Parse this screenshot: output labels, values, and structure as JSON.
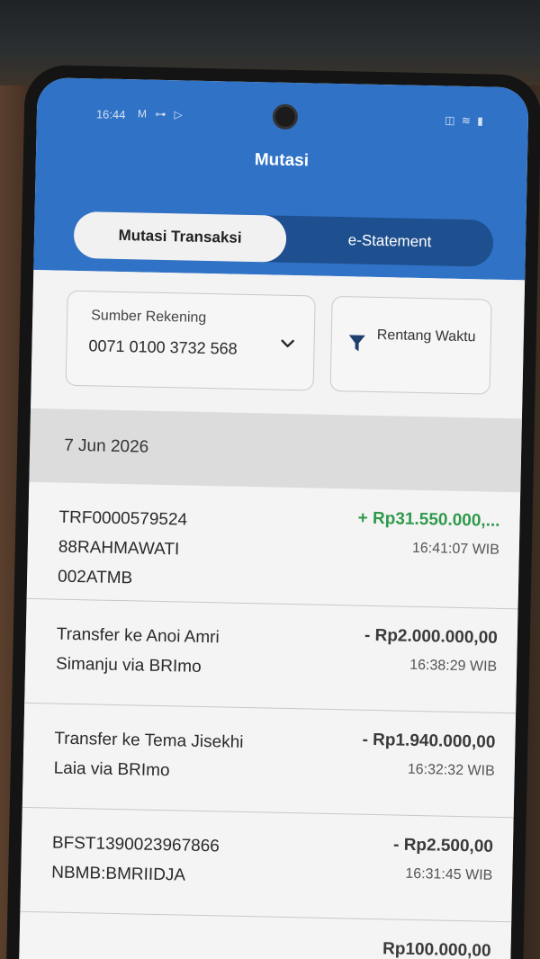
{
  "status_bar": {
    "time": "16:44",
    "left_icons": "M ⊶ ▷",
    "right_icons": "◫ ≋ ▮"
  },
  "header": {
    "title": "Mutasi",
    "tabs": [
      {
        "label": "Mutasi Transaksi",
        "active": true
      },
      {
        "label": "e-Statement",
        "active": false
      }
    ]
  },
  "filters": {
    "account": {
      "label": "Sumber Rekening",
      "value": "0071 0100 3732 568",
      "icon": "chevron-down-icon"
    },
    "range": {
      "label": "Rentang Waktu",
      "icon": "filter-icon"
    }
  },
  "date_group": "7 Jun 2026",
  "transactions": [
    {
      "description": "TRF0000579524 88RAHMAWATI 002ATMB",
      "amount": "+ Rp31.550.000,...",
      "time": "16:41:07 WIB",
      "direction": "in"
    },
    {
      "description": "Transfer ke Anoi Amri Simanju via BRImo",
      "amount": "- Rp2.000.000,00",
      "time": "16:38:29 WIB",
      "direction": "out"
    },
    {
      "description": "Transfer ke Tema Jisekhi Laia via BRImo",
      "amount": "- Rp1.940.000,00",
      "time": "16:32:32 WIB",
      "direction": "out"
    },
    {
      "description": "BFST1390023967866 NBMB:BMRIIDJA",
      "amount": "- Rp2.500,00",
      "time": "16:31:45 WIB",
      "direction": "out"
    },
    {
      "description": "",
      "amount": "Rp100.000,00",
      "time": "",
      "direction": "out"
    }
  ],
  "colors": {
    "header_blue": "#2f72c6",
    "tab_bar": "#1e4f8f",
    "credit_green": "#2f9a4b"
  }
}
